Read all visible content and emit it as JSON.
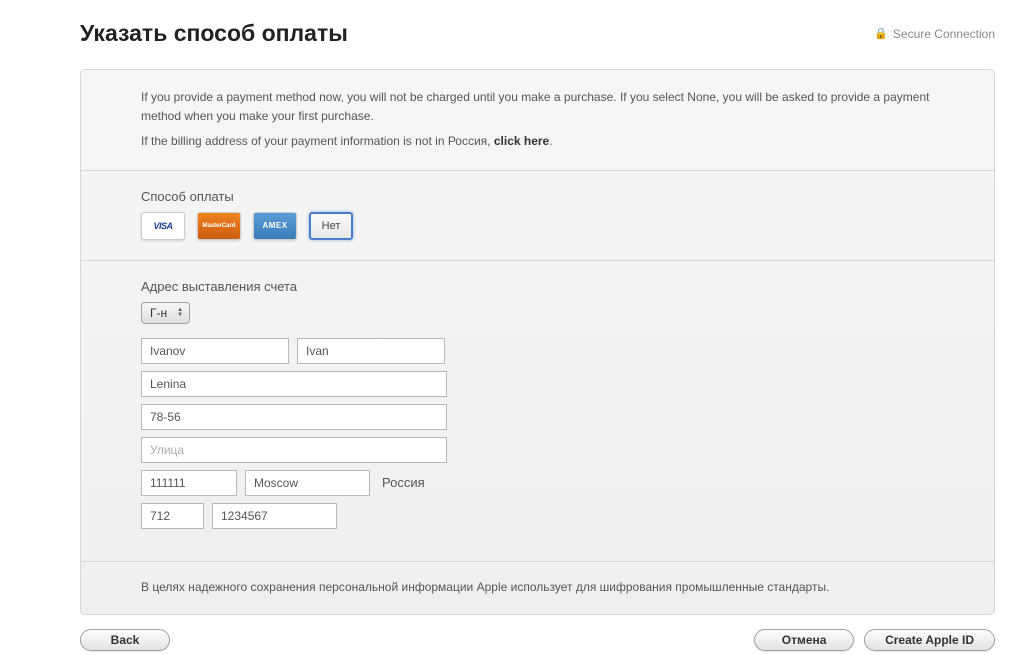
{
  "header": {
    "title": "Указать способ оплаты",
    "secure_label": "Secure Connection"
  },
  "info": {
    "line1": "If you provide a payment method now, you will not be charged until you make a purchase. If you select None, you will be asked to provide a payment method when you make your first purchase.",
    "line2_prefix": "If the billing address of your payment information is not in Россия, ",
    "click_here": "click here",
    "line2_suffix": "."
  },
  "payment": {
    "label": "Способ оплаты",
    "visa": "VISA",
    "mastercard": "MasterCard",
    "amex": "AMEX",
    "none": "Нет"
  },
  "billing": {
    "label": "Адрес выставления счета",
    "title_option": "Г-н",
    "lastname": "Ivanov",
    "firstname": "Ivan",
    "street": "Lenina",
    "apt": "78-56",
    "street2_placeholder": "Улица",
    "postal": "111111",
    "city": "Moscow",
    "country": "Россия",
    "area_code": "712",
    "phone": "1234567"
  },
  "footer": {
    "text": "В целях надежного сохранения персональной информации Apple использует для шифрования промышленные стандарты."
  },
  "buttons": {
    "back": "Back",
    "cancel": "Отмена",
    "create": "Create Apple ID"
  }
}
